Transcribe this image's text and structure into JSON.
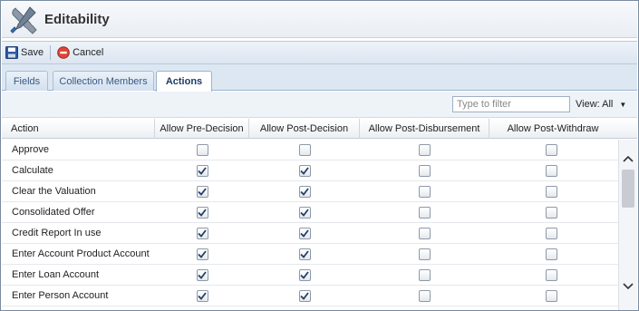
{
  "window": {
    "title": "Editability"
  },
  "toolbar": {
    "save_label": "Save",
    "cancel_label": "Cancel"
  },
  "tabs": [
    {
      "label": "Fields",
      "active": false
    },
    {
      "label": "Collection Members",
      "active": false
    },
    {
      "label": "Actions",
      "active": true
    }
  ],
  "filter": {
    "placeholder": "Type to filter",
    "value": ""
  },
  "view": {
    "label": "View: All"
  },
  "grid": {
    "columns": [
      "Action",
      "Allow Pre-Decision",
      "Allow Post-Decision",
      "Allow Post-Disbursement",
      "Allow Post-Withdraw"
    ],
    "rows": [
      {
        "action": "Approve",
        "checks": [
          false,
          false,
          false,
          false
        ]
      },
      {
        "action": "Calculate",
        "checks": [
          true,
          true,
          false,
          false
        ]
      },
      {
        "action": "Clear the Valuation",
        "checks": [
          true,
          true,
          false,
          false
        ]
      },
      {
        "action": "Consolidated Offer",
        "checks": [
          true,
          true,
          false,
          false
        ]
      },
      {
        "action": "Credit Report In use",
        "checks": [
          true,
          true,
          false,
          false
        ]
      },
      {
        "action": "Enter Account Product Account",
        "checks": [
          true,
          true,
          false,
          false
        ]
      },
      {
        "action": "Enter Loan Account",
        "checks": [
          true,
          true,
          false,
          false
        ]
      },
      {
        "action": "Enter Person Account",
        "checks": [
          true,
          true,
          false,
          false
        ]
      }
    ]
  },
  "colors": {
    "accent": "#1b3c66",
    "cancel_icon": "#d9362b",
    "save_icon": "#2d5aa0",
    "check_mark": "#23406b"
  },
  "icons": {
    "title": "wrench-screwdriver-icon",
    "save": "floppy-disk-icon",
    "cancel": "no-entry-icon",
    "view_dropdown": "caret-down-icon",
    "scroll_up": "chevron-up-icon",
    "scroll_down": "chevron-down-icon"
  }
}
